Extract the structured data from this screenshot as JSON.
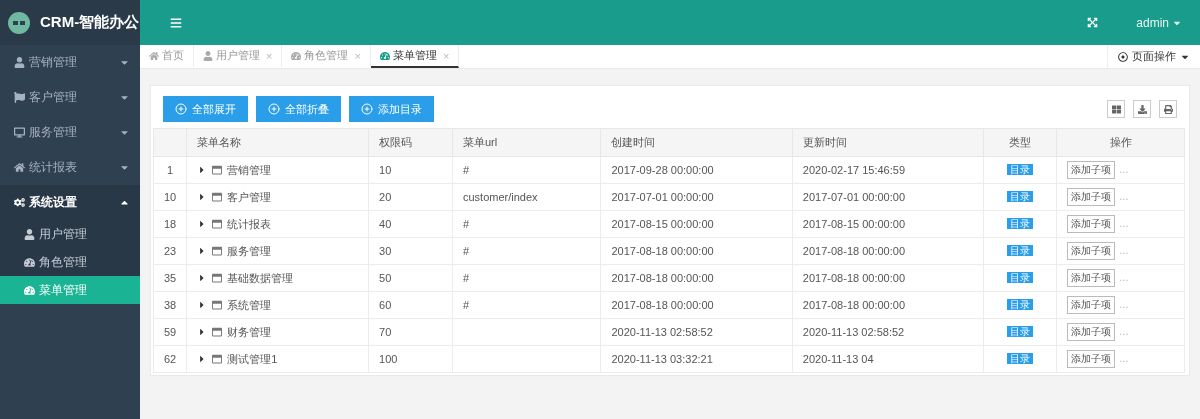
{
  "brand": {
    "title": "CRM-智能办公"
  },
  "sidebar": {
    "items": [
      {
        "label": "营销管理",
        "expanded": false
      },
      {
        "label": "客户管理",
        "expanded": false
      },
      {
        "label": "服务管理",
        "expanded": false
      },
      {
        "label": "统计报表",
        "expanded": false
      },
      {
        "label": "系统设置",
        "expanded": true,
        "children": [
          {
            "label": "用户管理",
            "selected": false
          },
          {
            "label": "角色管理",
            "selected": false
          },
          {
            "label": "菜单管理",
            "selected": true
          }
        ]
      }
    ]
  },
  "header": {
    "user": "admin"
  },
  "tabs": [
    {
      "label": "首页",
      "selected": false
    },
    {
      "label": "用户管理",
      "close": "×",
      "selected": false
    },
    {
      "label": "角色管理",
      "close": "×",
      "selected": false
    },
    {
      "label": "菜单管理",
      "close": "×",
      "selected": true
    }
  ],
  "page_actions": {
    "label": "页面操作"
  },
  "toolbar": {
    "buttons": [
      "全部展开",
      "全部折叠",
      "添加目录"
    ]
  },
  "table": {
    "columns": [
      "菜单名称",
      "权限码",
      "菜单url",
      "创建时间",
      "更新时间",
      "类型",
      "操作"
    ],
    "rows": [
      {
        "index": "1",
        "name": "营销管理",
        "code": "10",
        "url": "#",
        "created": "2017-09-28 00:00:00",
        "updated": "2020-02-17 15:46:59",
        "type": "目录",
        "action": "添加子项",
        "more": "..."
      },
      {
        "index": "10",
        "name": "客户管理",
        "code": "20",
        "url": "customer/index",
        "created": "2017-07-01 00:00:00",
        "updated": "2017-07-01 00:00:00",
        "type": "目录",
        "action": "添加子项",
        "more": "..."
      },
      {
        "index": "18",
        "name": "统计报表",
        "code": "40",
        "url": "#",
        "created": "2017-08-15 00:00:00",
        "updated": "2017-08-15 00:00:00",
        "type": "目录",
        "action": "添加子项",
        "more": "..."
      },
      {
        "index": "23",
        "name": "服务管理",
        "code": "30",
        "url": "#",
        "created": "2017-08-18 00:00:00",
        "updated": "2017-08-18 00:00:00",
        "type": "目录",
        "action": "添加子项",
        "more": "..."
      },
      {
        "index": "35",
        "name": "基础数据管理",
        "code": "50",
        "url": "#",
        "created": "2017-08-18 00:00:00",
        "updated": "2017-08-18 00:00:00",
        "type": "目录",
        "action": "添加子项",
        "more": "..."
      },
      {
        "index": "38",
        "name": "系统管理",
        "code": "60",
        "url": "#",
        "created": "2017-08-18 00:00:00",
        "updated": "2017-08-18 00:00:00",
        "type": "目录",
        "action": "添加子项",
        "more": "..."
      },
      {
        "index": "59",
        "name": "财务管理",
        "code": "70",
        "created": "2020-11-13 02:58:52",
        "updated": "2020-11-13 02:58:52",
        "type": "目录",
        "action": "添加子项",
        "more": "..."
      },
      {
        "index": "62",
        "name": "测试管理1",
        "code": "100",
        "created": "2020-11-13 03:32:21",
        "updated": "2020-11-13 04",
        "type": "目录",
        "action": "添加子项",
        "more": "..."
      }
    ]
  }
}
